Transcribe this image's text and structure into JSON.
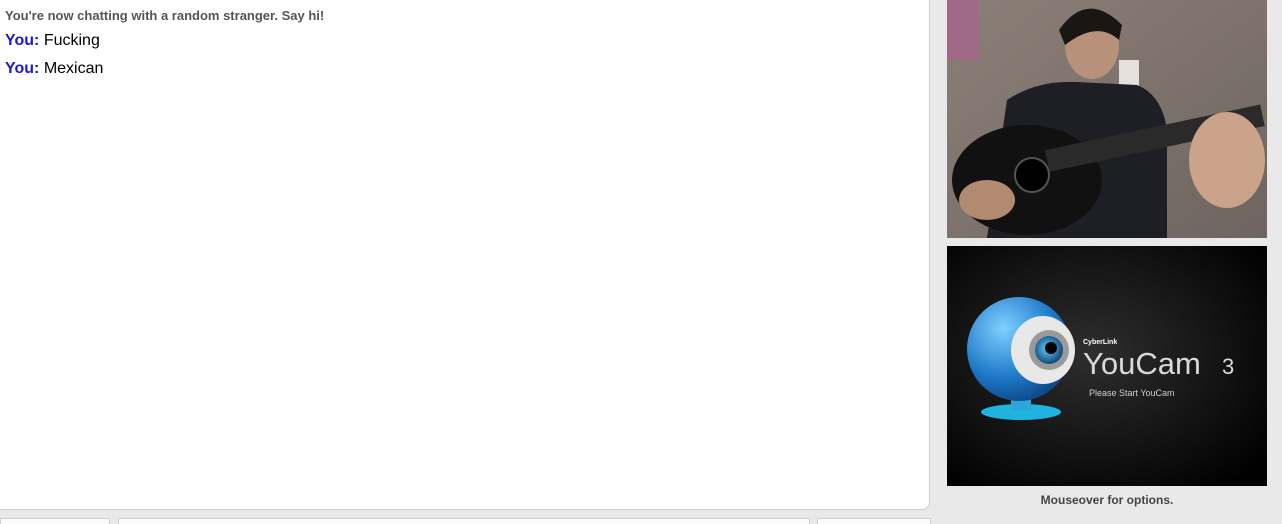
{
  "chat": {
    "status": "You're now chatting with a random stranger. Say hi!",
    "messages": [
      {
        "sender": "You:",
        "text": "Fucking"
      },
      {
        "sender": "You:",
        "text": "Mexican"
      }
    ]
  },
  "video_self": {
    "brand_small": "CyberLink",
    "brand_name": "YouCam",
    "brand_version": "3",
    "prompt": "Please Start YouCam"
  },
  "video_hint": "Mouseover for options.",
  "colors": {
    "you_label": "#1a1acb",
    "status_text": "#555555",
    "page_bg": "#e9e9e9"
  }
}
